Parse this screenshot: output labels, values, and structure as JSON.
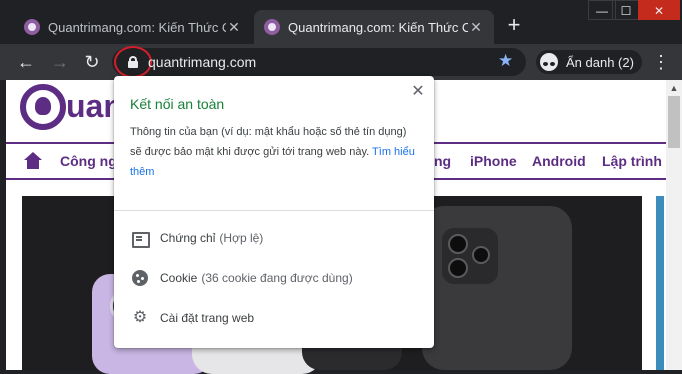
{
  "tabs": [
    {
      "title": "Quantrimang.com: Kiến Thức Công",
      "close": "✕"
    },
    {
      "title": "Quantrimang.com: Kiến Thức Công",
      "close": "✕"
    }
  ],
  "newtab": "+",
  "window_controls": {
    "min": "—",
    "max": "☐",
    "close": "✕"
  },
  "toolbar": {
    "back": "←",
    "forward": "→",
    "reload": "↻",
    "url": "quantrimang.com",
    "star": "★",
    "incognito_label": "Ẩn danh (2)",
    "menu": "⋮"
  },
  "site": {
    "logo_text": "uan",
    "nav_items": [
      "Công nghệ",
      "ng",
      "iPhone",
      "Android",
      "Lập trình"
    ]
  },
  "popup": {
    "title": "Kết nối an toàn",
    "description": "Thông tin của bạn (ví dụ: mật khẩu hoặc số thẻ tín dụng) sẽ được bảo mật khi được gửi tới trang web này.",
    "link": "Tìm hiểu thêm",
    "close": "✕",
    "rows": [
      {
        "label": "Chứng chỉ",
        "sub": "(Hợp lệ)",
        "icon": "certificate-icon"
      },
      {
        "label": "Cookie",
        "sub": "(36 cookie đang được dùng)",
        "icon": "cookie-icon"
      },
      {
        "label": "Cài đặt trang web",
        "sub": "",
        "icon": "gear-icon"
      }
    ],
    "gear_glyph": "⚙"
  },
  "colors": {
    "title_green": "#188038",
    "link_blue": "#1a73e8",
    "brand_purple": "#5d2d83",
    "highlight_red": "#d21f2b"
  }
}
